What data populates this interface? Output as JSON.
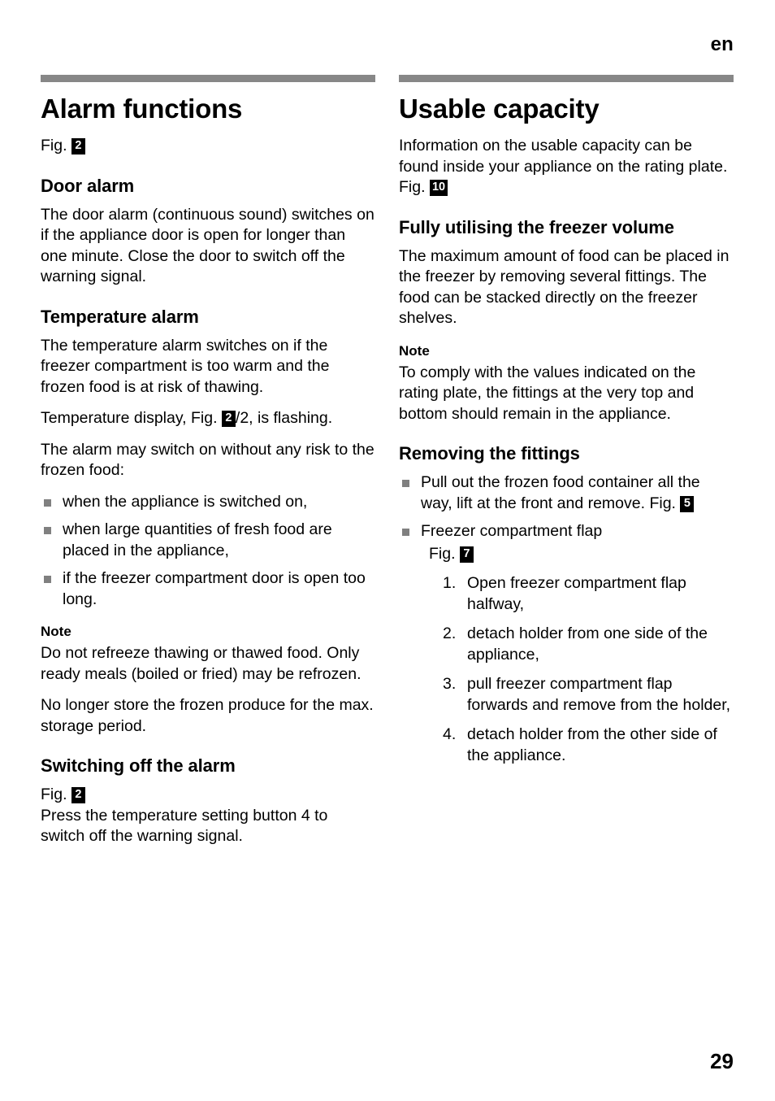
{
  "page": {
    "language_marker": "en",
    "folio": "29"
  },
  "left_column": {
    "chapter_title": "Alarm functions",
    "chapter_figref_prefix": "Fig.",
    "chapter_figref": "2",
    "sections": [
      {
        "heading": "Door alarm",
        "paragraphs": [
          "The door alarm (continuous sound) switches on if the appliance door is open for longer than one minute. Close the door to switch off the warning signal."
        ]
      },
      {
        "heading": "Temperature alarm",
        "paragraphs": [
          "The temperature alarm switches on if the freezer compartment is too warm and the frozen food is at risk of thawing."
        ],
        "temp_display_line": {
          "before": "Temperature display, Fig.",
          "figref": "2",
          "after": "/2, is flashing."
        },
        "lead_in": "The alarm may switch on without any risk to the frozen food:",
        "bullets": [
          "when the appliance is switched on,",
          "when large quantities of fresh food are placed in the appliance,",
          "if the freezer compartment door is open too long."
        ],
        "note_heading": "Note",
        "note_paragraphs": [
          "Do not refreeze thawing or thawed food. Only ready meals (boiled or fried) may be refrozen.",
          "No longer store the frozen produce for the max. storage period."
        ]
      },
      {
        "heading": "Switching off the alarm",
        "figref_prefix": "Fig.",
        "figref": "2",
        "paragraphs": [
          "Press the temperature setting button 4 to switch off the warning signal."
        ]
      }
    ]
  },
  "right_column": {
    "chapter_title": "Usable capacity",
    "intro": {
      "before": "Information on the usable capacity can be found inside your appliance on the rating plate. Fig.",
      "figref": "10"
    },
    "sections": [
      {
        "heading": "Fully utilising the freezer volume",
        "paragraphs": [
          "The maximum amount of food can be placed in the freezer by removing several fittings. The food can be stacked directly on the freezer shelves."
        ],
        "note_heading": "Note",
        "note_paragraphs": [
          "To comply with the values indicated on the rating plate, the fittings at the very top and bottom should remain in the appliance."
        ]
      },
      {
        "heading": "Removing the fittings",
        "bullets": [
          {
            "text": "Pull out the frozen food container all the way, lift at the front and remove.",
            "figref_prefix": "Fig.",
            "figref": "5",
            "figref_inline": true
          },
          {
            "text": "Freezer compartment flap",
            "figref_prefix": "Fig.",
            "figref": "7",
            "figref_inline": false
          }
        ],
        "steps": [
          {
            "num": "1.",
            "text": "Open freezer compartment flap halfway,"
          },
          {
            "num": "2.",
            "text": "detach holder from one side of the appliance,"
          },
          {
            "num": "3.",
            "text": "pull freezer compartment flap forwards and remove from the holder,"
          },
          {
            "num": "4.",
            "text": "detach holder from the other side of the appliance."
          }
        ]
      }
    ]
  },
  "colors": {
    "rule": "#878787",
    "bullet": "#808080",
    "figref_background": "#000000",
    "figref_text": "#ffffff",
    "text": "#000000",
    "page_background": "#ffffff"
  }
}
